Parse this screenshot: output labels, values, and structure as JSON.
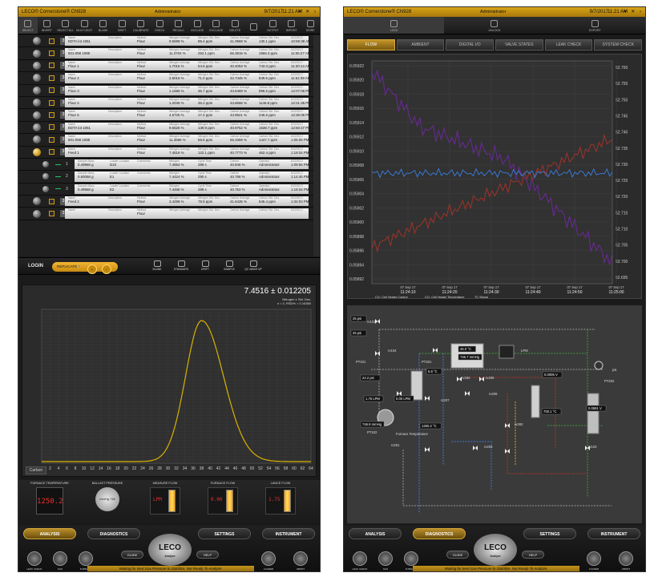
{
  "left": {
    "title": "LECO® Cornerstone® CN928",
    "user": "Administrator",
    "date": "9/7/2017",
    "time": "11:21 AM",
    "window_controls": "▾ ✕ ›",
    "toolbar": [
      {
        "label": "SELECT",
        "icon": "select-icon"
      },
      {
        "label": "INVERT",
        "icon": "invert-icon"
      },
      {
        "label": "SELECT ALL",
        "icon": "select-all-icon"
      },
      {
        "label": "MULTI-EDIT",
        "icon": "multi-edit-icon"
      },
      {
        "label": "BLANK",
        "icon": "blank-icon"
      },
      {
        "label": "DRIFT",
        "icon": "drift-icon"
      },
      {
        "label": "CALIBRATE",
        "icon": "calibrate-icon"
      },
      {
        "label": "CHECK",
        "icon": "check-icon"
      },
      {
        "label": "RECALC",
        "icon": "recalc-icon"
      },
      {
        "label": "INCLUDE",
        "icon": "include-icon"
      },
      {
        "label": "EXCLUDE",
        "icon": "exclude-icon"
      },
      {
        "label": "DELETE",
        "icon": "delete-icon"
      },
      {
        "label": "",
        "icon": "blank-icon"
      },
      {
        "label": "OUTPUT",
        "icon": "output-icon"
      },
      {
        "label": "IMPORT",
        "icon": "import-icon"
      },
      {
        "label": "MORE",
        "icon": "more-icon"
      }
    ],
    "headers": {
      "name": "Name",
      "description": "Description",
      "method": "Method",
      "n_avg": "Nitrogen Average",
      "n_std": "Nitrogen Std. Dev.",
      "c_avg": "Carbon Average",
      "c_std": "Carbon Std. Dev."
    },
    "sub_headers": {
      "mass": "Sample Mass",
      "loc": "Loader Location",
      "comments": "Comments",
      "nitrogen": "Nitrogen",
      "cycle": "Cycle Time",
      "carbon": "Carbon",
      "operator": "Operator"
    },
    "samples": [
      {
        "rep": "3",
        "name": "EDTA lot 1061",
        "method": "Flour",
        "n_avg": "9.5699 %",
        "n_std": "89.4 ppm",
        "c_avg": "41.0969 %",
        "c_std": "130.1 ppm",
        "date": "6/22/2017",
        "time": "10:59:38 AM"
      },
      {
        "rep": "3",
        "name": "501-058 1088",
        "method": "Flour",
        "n_avg": "11.3704 %",
        "n_std": "252.1 ppm",
        "c_avg": "66.3915 %",
        "c_std": "1556.3 ppm",
        "date": "6/22/2017",
        "time": "11:06:27 AM"
      },
      {
        "rep": "3",
        "name": "Flour 1",
        "method": "Flour",
        "n_avg": "1.7015 %",
        "n_std": "54.6 ppm",
        "c_avg": "40.4053 %",
        "c_std": "743.3 ppm",
        "date": "6/22/2017",
        "time": "11:30:14 AM"
      },
      {
        "rep": "3",
        "name": "Flour 2",
        "method": "Flour",
        "n_avg": "2.5015 %",
        "n_std": "71.0 ppm",
        "c_avg": "42.7445 %",
        "c_std": "849.5 ppm",
        "date": "6/22/2017",
        "time": "11:52:39 AM"
      },
      {
        "rep": "3",
        "name": "Flour 3",
        "method": "Flour",
        "n_avg": "1.1586 %",
        "n_std": "36.7 ppm",
        "c_avg": "43.6469 %",
        "c_std": "896.5 ppm",
        "date": "6/22/2017",
        "time": "12:07:06 PM"
      },
      {
        "rep": "3",
        "name": "Flour 4",
        "method": "Flour",
        "n_avg": "1.2045 %",
        "n_std": "45.2 ppm",
        "c_avg": "43.6666 %",
        "c_std": "1146.8 ppm",
        "date": "6/22/2017",
        "time": "12:21:36 PM"
      },
      {
        "rep": "3",
        "name": "Flour 5",
        "method": "Flour",
        "n_avg": "4.5725 %",
        "n_std": "17.4 ppm",
        "c_avg": "43.9521 %",
        "c_std": "246.6 ppm",
        "date": "6/22/2017",
        "time": "12:36:08 PM"
      },
      {
        "rep": "3",
        "name": "EDTA lot 1061",
        "method": "Flour",
        "n_avg": "9.5526 %",
        "n_std": "139.9 ppm",
        "c_avg": "40.9752 %",
        "c_std": "1538.7 ppm",
        "date": "6/22/2017",
        "time": "12:50:47 PM"
      },
      {
        "rep": "3",
        "name": "501-058 1088",
        "method": "Flour",
        "n_avg": "11.3696 %",
        "n_std": "59.6 ppm",
        "c_avg": "66.3369 %",
        "c_std": "1447.7 ppm",
        "date": "6/22/2017",
        "time": "1:05:06 PM"
      },
      {
        "rep": "3",
        "name": "Feed 1",
        "method": "Flour",
        "n_avg": "7.4516 %",
        "n_std": "122.1 ppm",
        "c_avg": "40.7773 %",
        "c_std": "462.4 ppm",
        "date": "6/22/2017",
        "time": "1:19:34 PM",
        "expanded": true
      }
    ],
    "replicates": [
      {
        "num": "1",
        "mass": "0.49968 g",
        "loc": "D10",
        "nitrogen": "7.4654 %",
        "cycle": "289 s",
        "carbon": "40.846 %",
        "operator": "Administrator",
        "date": "6/22/2017",
        "time": "1:09:55 PM"
      },
      {
        "num": "2",
        "mass": "0.50058 g",
        "loc": "E1",
        "nitrogen": "7.4424 %",
        "cycle": "290 s",
        "carbon": "40.768 %",
        "operator": "Administrator",
        "date": "6/22/2017",
        "time": "1:14:45 PM"
      },
      {
        "num": "3",
        "mass": "0.49968 g",
        "loc": "E2",
        "nitrogen": "7.4468 %",
        "cycle": "289 s",
        "carbon": "40.753 %",
        "operator": "Administrator",
        "date": "6/22/2017",
        "time": "1:19:34 PM"
      }
    ],
    "samples_after": [
      {
        "rep": "3",
        "name": "Feed 2",
        "method": "Flour",
        "n_avg": "3.4298 %",
        "n_std": "78.9 ppm",
        "c_avg": "41.6435 %",
        "c_std": "545.4 ppm",
        "date": "6/22/2017",
        "time": "1:34:03 PM"
      },
      {
        "rep": "3",
        "name": "",
        "method": "Flour",
        "n_avg": "",
        "n_std": "",
        "c_avg": "",
        "c_std": "",
        "date": "6/22/2017",
        "time": ""
      }
    ],
    "login": {
      "login_label": "LOGIN",
      "replicates_label": "REPLICATES",
      "replicates_count": "1",
      "plus": "+",
      "minus": "−",
      "quick": [
        {
          "label": "BLANK",
          "icon": "blank-icon"
        },
        {
          "label": "STANDARD",
          "icon": "standard-icon"
        },
        {
          "label": "DRIFT",
          "icon": "drift-icon"
        },
        {
          "label": "SAMPLE",
          "icon": "sample-icon"
        },
        {
          "label": "QC WAKE UP",
          "icon": "qc-wake-up-icon"
        }
      ]
    },
    "peak": {
      "value": "7.4516 ± 0.012205",
      "stats1": "Nitrogen ± Std. Dev.",
      "stats2": "n = 3, RSD% = 0.16380",
      "tab": "Carbon",
      "color": "#d9b200",
      "x_ticks": [
        "0",
        "2",
        "4",
        "6",
        "8",
        "10",
        "12",
        "14",
        "16",
        "18",
        "20",
        "22",
        "24",
        "26",
        "28",
        "30",
        "32",
        "34",
        "36",
        "38",
        "40",
        "42",
        "44",
        "46",
        "48",
        "50",
        "52",
        "54",
        "56",
        "58",
        "60",
        "62",
        "64"
      ]
    },
    "gauges": [
      {
        "label": "FURNACE TEMPERATURE",
        "value": "1250.2",
        "kind": "digital"
      },
      {
        "label": "BALLAST PRESSURE",
        "value": "mmHg 746",
        "kind": "dial"
      },
      {
        "label": "MEASURE FLOW",
        "value": "LPM",
        "kind": "flow"
      },
      {
        "label": "FURNACE FLOW",
        "value": "0.00",
        "kind": "flow"
      },
      {
        "label": "LANCE FLOW",
        "value": "1.75",
        "kind": "flow"
      }
    ],
    "nav": {
      "tabs": [
        "ANALYSIS",
        "DIAGNOSTICS",
        "SETTINGS",
        "INSTRUMENT"
      ],
      "active": 0,
      "logo": "LECO",
      "logo_sub": "Analyze",
      "guide": "GUIDE",
      "help": "HELP",
      "icons_left": [
        {
          "label": "LEAK CHECK",
          "icon": "leak-check-icon"
        },
        {
          "label": "GAS",
          "icon": "gas-icon"
        },
        {
          "label": "FURNACE",
          "icon": "furnace-icon"
        }
      ],
      "icons_right": [
        {
          "label": "LOADER",
          "icon": "loader-icon"
        },
        {
          "label": "ABORT",
          "icon": "abort-icon"
        }
      ],
      "status": "Waiting for Inert Gas Pressure to Stabilize.  Not Ready To Analyze."
    }
  },
  "right": {
    "title": "LECO® Cornerstone® CN928",
    "user": "Administrator",
    "date": "9/7/2017",
    "time": "11:21 AM",
    "window_controls": "▾ ✕ ›",
    "toolbar": [
      {
        "label": "LOCK",
        "icon": "lock-icon"
      },
      {
        "label": "UNLOCK",
        "icon": "unlock-icon"
      },
      {
        "label": "EXPORT",
        "icon": "export-icon"
      }
    ],
    "tabs": [
      "FLOW",
      "AMBIENT",
      "DIGITAL I/O",
      "VALVE STATES",
      "LEAK CHECK",
      "SYSTEM CHECK"
    ],
    "active_tab": 0,
    "trend": {
      "left_ticks": [
        "0.05922",
        "0.05920",
        "0.05918",
        "0.05916",
        "0.05914",
        "0.05912",
        "0.05910",
        "0.05908",
        "0.05906",
        "0.05904",
        "0.05902",
        "0.05900",
        "0.05898",
        "0.05896",
        "0.05894",
        "0.05892"
      ],
      "right_ticks": [
        "52.760",
        "52.755",
        "52.750",
        "52.745",
        "52.740",
        "52.735",
        "52.730",
        "52.725",
        "52.720",
        "52.715",
        "52.710",
        "52.705",
        "52.700",
        "52.695"
      ],
      "x_ticks": [
        {
          "d": "07 Sep 17",
          "t": "11:24:10"
        },
        {
          "d": "07 Sep 17",
          "t": "11:24:20"
        },
        {
          "d": "07 Sep 17",
          "t": "11:24:30"
        },
        {
          "d": "07 Sep 17",
          "t": "11:24:40"
        },
        {
          "d": "07 Sep 17",
          "t": "11:24:50"
        },
        {
          "d": "07 Sep 17",
          "t": "11:25:00"
        }
      ],
      "legend": [
        "CO₂ Cell Heater Control",
        "CO₂ Cell Heater Temperature",
        "TC Signal"
      ],
      "colors": {
        "purple": "#6a2a9a",
        "red": "#a0322a",
        "blue": "#3a78d0"
      }
    },
    "schematic": {
      "labels": [
        {
          "text": "25 psi"
        },
        {
          "text": "25 psi"
        },
        {
          "text": "rv101"
        },
        {
          "text": "rv104"
        },
        {
          "text": "PT101"
        },
        {
          "text": "LPM"
        },
        {
          "text": "psi"
        },
        {
          "text": "PT202"
        },
        {
          "text": "24.2 psi"
        },
        {
          "text": "1.75 LPM"
        },
        {
          "text": "0.00 LPM"
        },
        {
          "text": "rv207"
        },
        {
          "text": "rv204"
        },
        {
          "text": "rv205"
        },
        {
          "text": "rv206"
        },
        {
          "text": "0.0005 V"
        },
        {
          "text": "700.1 °C"
        },
        {
          "text": "rv282"
        },
        {
          "text": "0.0591 V"
        },
        {
          "text": "rv203"
        },
        {
          "text": "rv201"
        },
        {
          "text": "rv103"
        },
        {
          "text": "1250.2 °C"
        },
        {
          "text": "Furnace Temperature"
        },
        {
          "text": "746.9 mmHg"
        },
        {
          "text": "PT102"
        },
        {
          "text": "5.8 °C"
        },
        {
          "text": "45.0 °C"
        },
        {
          "text": "745.7 mmHg"
        },
        {
          "text": "PT103"
        },
        {
          "text": "PT201"
        }
      ]
    },
    "nav": {
      "tabs": [
        "ANALYSIS",
        "DIAGNOSTICS",
        "SETTINGS",
        "INSTRUMENT"
      ],
      "active": 1,
      "logo": "LECO",
      "logo_sub": "Analyze",
      "guide": "GUIDE",
      "help": "HELP",
      "icons_left": [
        {
          "label": "LEAK CHECK",
          "icon": "leak-check-icon"
        },
        {
          "label": "GAS",
          "icon": "gas-icon"
        },
        {
          "label": "FURNACE",
          "icon": "furnace-icon"
        }
      ],
      "icons_right": [
        {
          "label": "LOADER",
          "icon": "loader-icon"
        },
        {
          "label": "ABORT",
          "icon": "abort-icon"
        }
      ],
      "status": "Waiting for Inert Gas Pressure to Stabilize.  Not Ready To Analyze."
    }
  }
}
